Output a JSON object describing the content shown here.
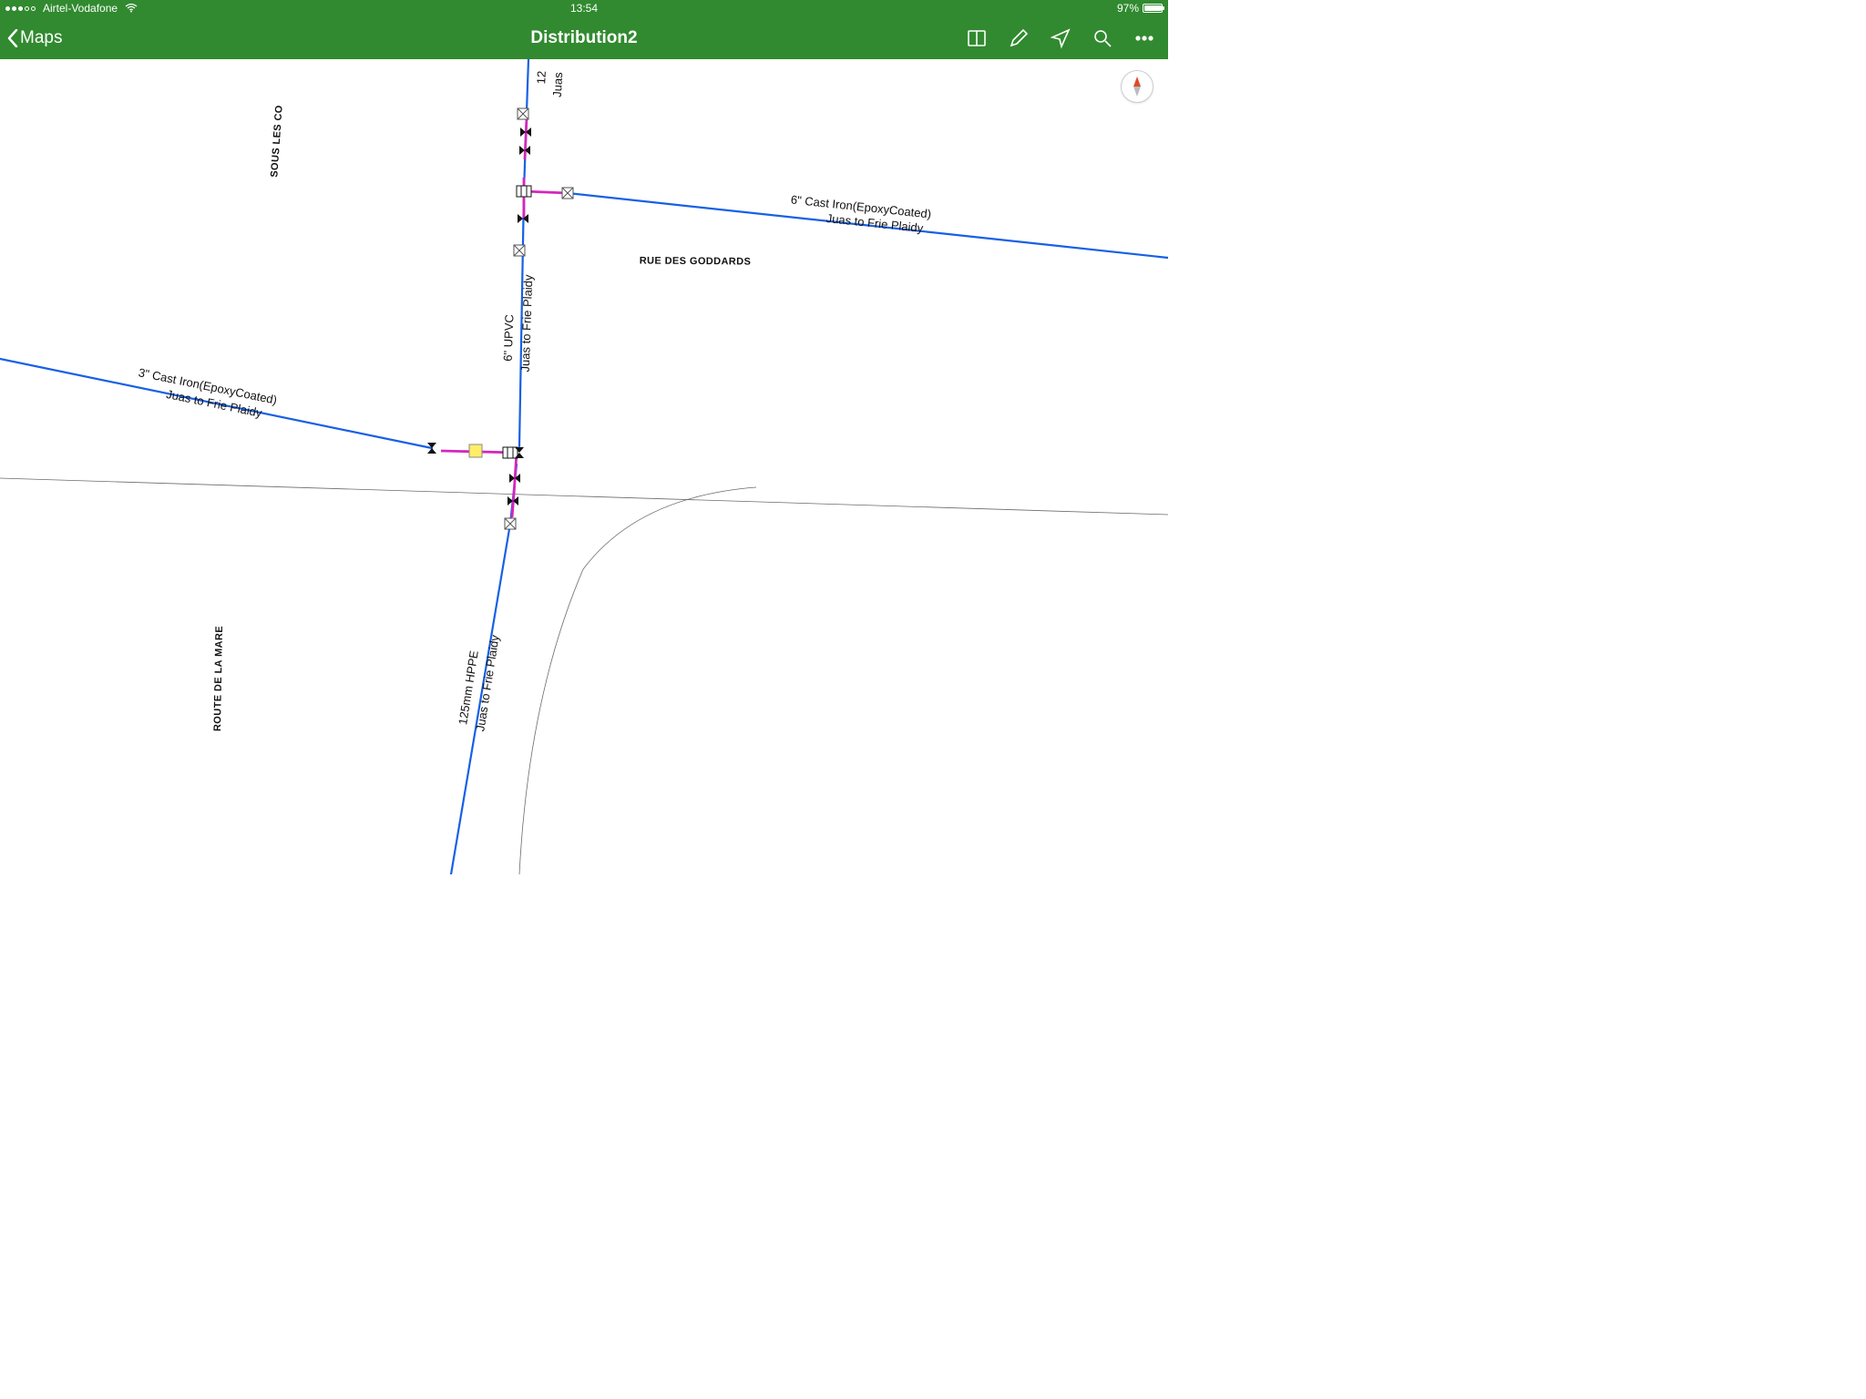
{
  "status": {
    "carrier": "Airtel-Vodafone",
    "time": "13:54",
    "battery_pct": "97%"
  },
  "nav": {
    "back_label": "Maps",
    "title": "Distribution2"
  },
  "streets": {
    "sous_les_co": "SOUS LES CO",
    "rue_des_goddards": "RUE DES GODDARDS",
    "route_de_la_mare": "ROUTE DE LA MARE"
  },
  "pipes": {
    "p1": {
      "spec": "6\" Cast Iron(EpoxyCoated)",
      "route": "Juas to Frie Plaidy"
    },
    "p2": {
      "spec": "3\" Cast Iron(EpoxyCoated)",
      "route": "Juas to Frie Plaidy"
    },
    "p3": {
      "spec": "6\" UPVC",
      "route": "Juas to Frie Plaidy"
    },
    "p4": {
      "spec": "125mm HPPE",
      "route": "Juas to Frie Plaidy"
    },
    "p5": {
      "spec": "12",
      "route": "Juas"
    }
  },
  "colors": {
    "brand": "#318a2f",
    "pipe": "#1760e6",
    "connector": "#d426bd",
    "road": "#6b6b6b"
  }
}
